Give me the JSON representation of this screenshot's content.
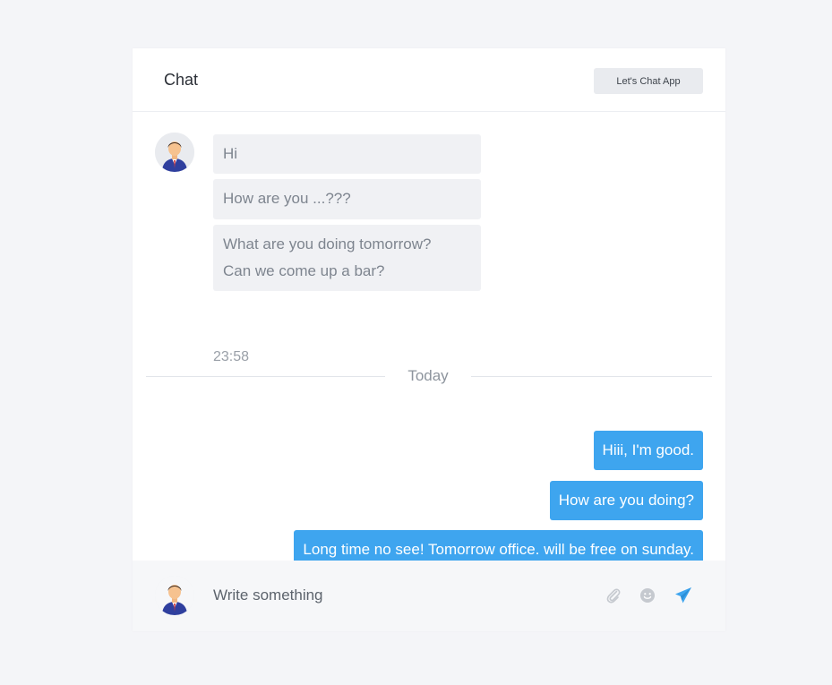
{
  "header": {
    "title": "Chat",
    "badge": "Let's Chat App"
  },
  "messages_in": {
    "bubbles": [
      "Hi",
      "How are you ...???",
      "What are you doing tomorrow?\nCan we come up a bar?"
    ],
    "time": "23:58"
  },
  "divider": {
    "label": "Today"
  },
  "messages_out": {
    "bubbles": [
      "Hiii, I'm good.",
      "How are you doing?",
      "Long time no see! Tomorrow office. will be free on sunday."
    ]
  },
  "composer": {
    "placeholder": "Write something",
    "icons": [
      "paperclip-icon",
      "smiley-icon",
      "send-icon"
    ]
  },
  "colors": {
    "accent": "#3ea5ef",
    "incoming_bubble": "#f0f1f4",
    "background": "#f4f5f8"
  }
}
